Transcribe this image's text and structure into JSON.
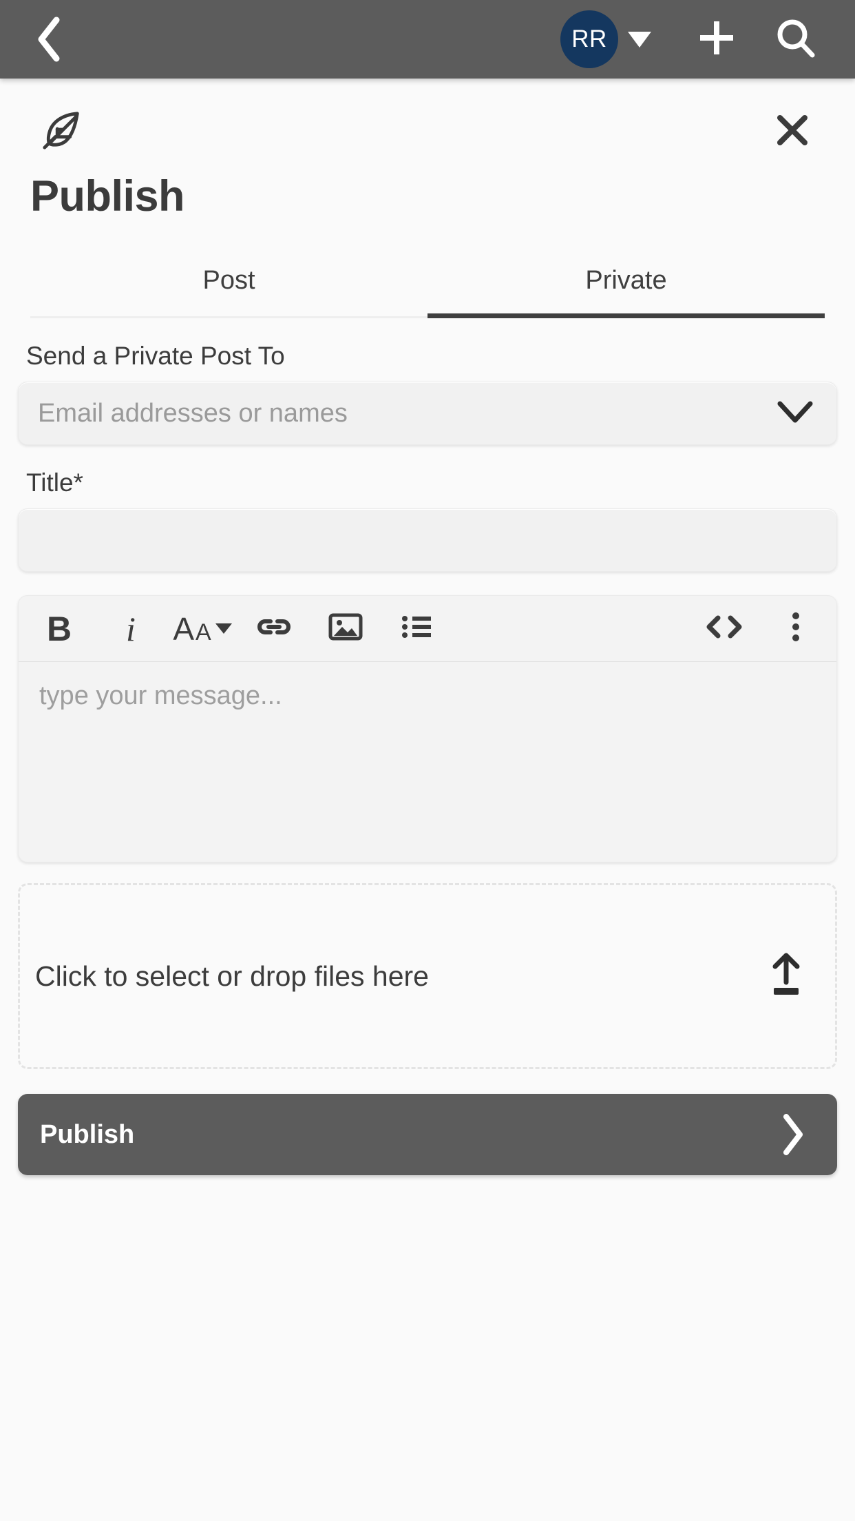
{
  "appbar": {
    "back_icon": "chevron-left-icon",
    "account": {
      "initials": "RR",
      "caret_icon": "caret-down-icon",
      "avatar_color": "#14375f"
    },
    "add_icon": "plus-icon",
    "search_icon": "search-icon",
    "background_color": "#5c5c5c"
  },
  "sheet": {
    "brand_icon": "feather-icon",
    "close_icon": "close-icon",
    "title": "Publish",
    "tabs": [
      {
        "label": "Post",
        "active": false
      },
      {
        "label": "Private",
        "active": true
      }
    ]
  },
  "form": {
    "recipients": {
      "label": "Send a Private Post To",
      "placeholder": "Email addresses or names",
      "value": "",
      "chevron_icon": "chevron-down-icon"
    },
    "title_field": {
      "label": "Title*",
      "placeholder": "",
      "value": ""
    },
    "editor": {
      "placeholder": "type your message...",
      "value": "",
      "toolbar": [
        {
          "name": "bold-icon",
          "label": "B"
        },
        {
          "name": "italic-icon",
          "label": "i"
        },
        {
          "name": "font-size-icon",
          "label": "Aa"
        },
        {
          "name": "link-icon",
          "label": ""
        },
        {
          "name": "image-icon",
          "label": ""
        },
        {
          "name": "bulleted-list-icon",
          "label": ""
        },
        {
          "name": "code-icon",
          "label": ""
        },
        {
          "name": "more-options-icon",
          "label": ""
        }
      ]
    },
    "dropzone": {
      "text": "Click to select or drop files here",
      "upload_icon": "upload-icon"
    }
  },
  "footer": {
    "publish_label": "Publish",
    "chevron_icon": "chevron-right-icon",
    "background_color": "#5c5c5c"
  }
}
